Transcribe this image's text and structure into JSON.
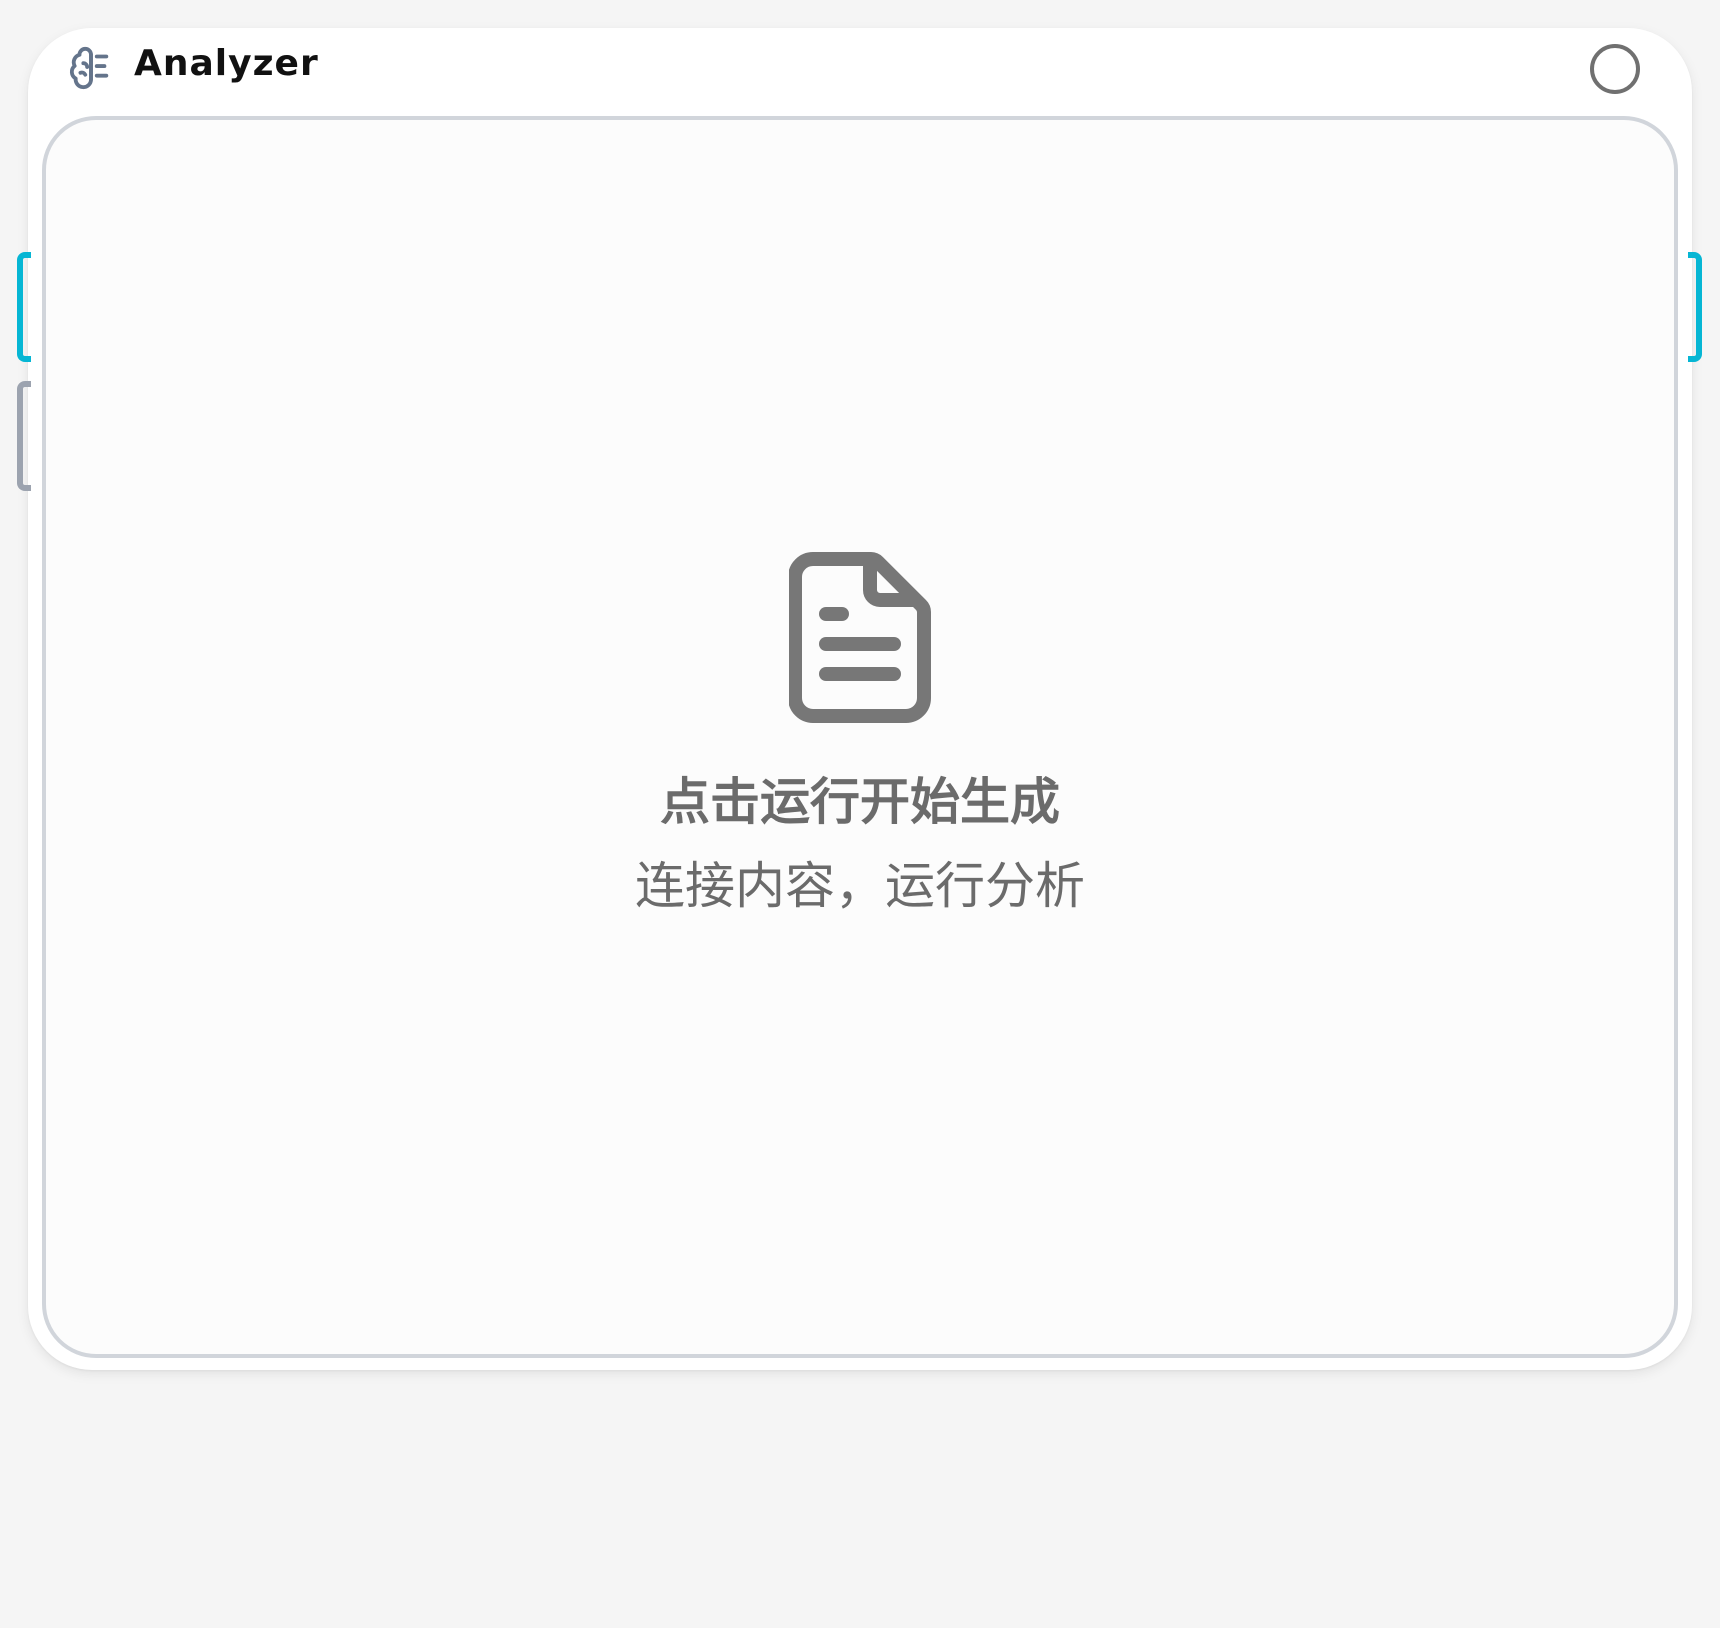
{
  "node": {
    "title": "Analyzer",
    "header_icon": "brain-icon",
    "status_icon": "status-ring-icon"
  },
  "empty_state": {
    "icon": "document-icon",
    "title": "点击运行开始生成",
    "subtitle": "连接内容，运行分析"
  },
  "colors": {
    "accent": "#06b6d4",
    "handle_inactive": "#9ca3af",
    "text_muted": "#6b6b6b",
    "border": "#d1d5db"
  }
}
